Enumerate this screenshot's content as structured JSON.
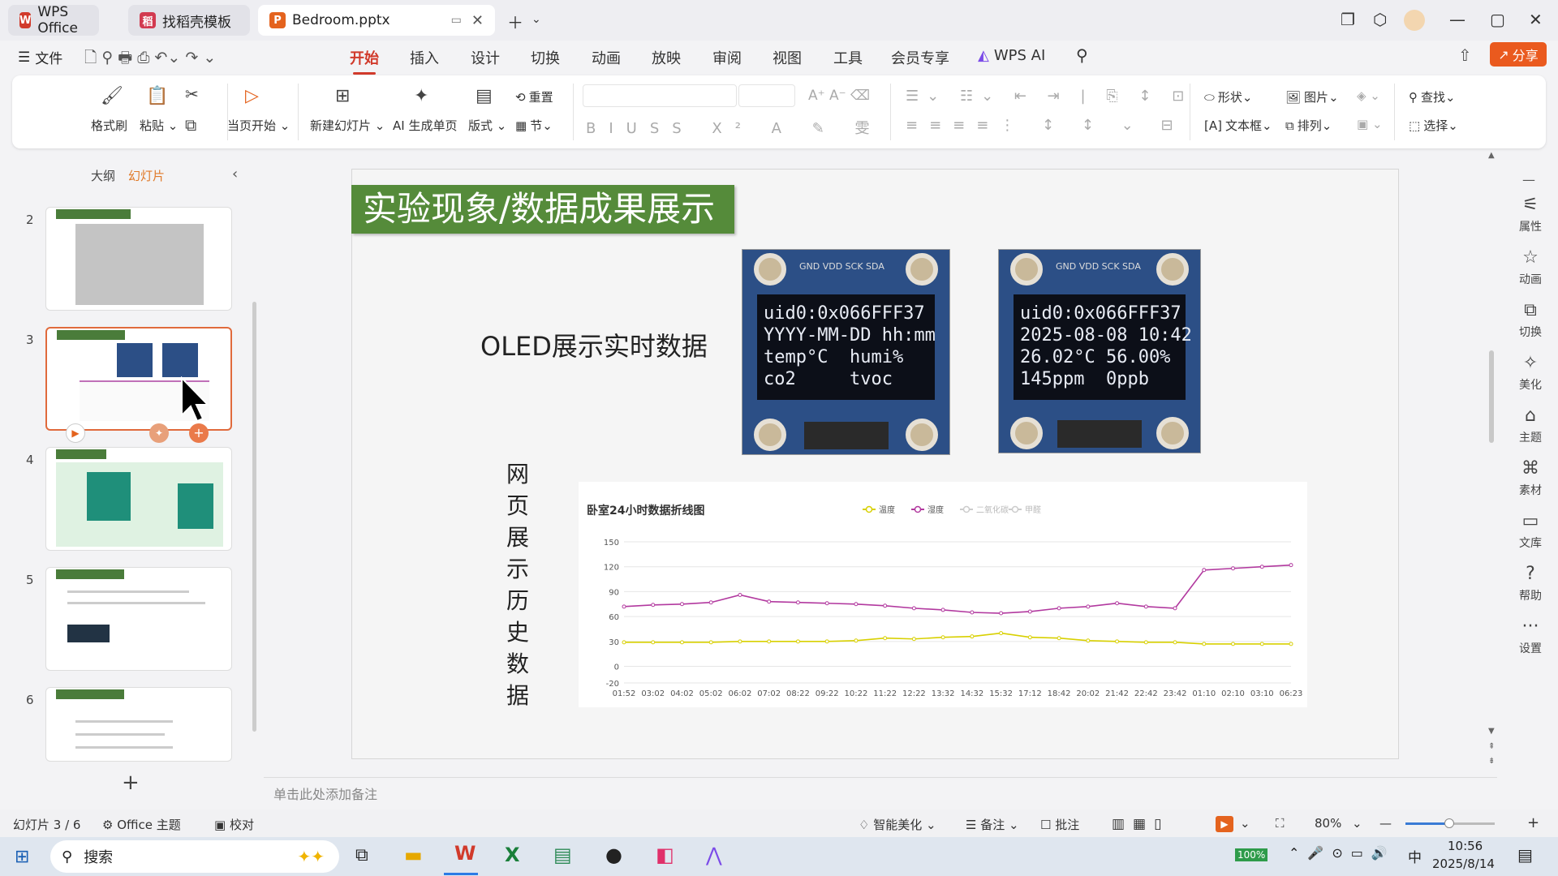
{
  "tabs": [
    {
      "label": "WPS Office"
    },
    {
      "label": "找稻壳模板"
    },
    {
      "label": "Bedroom.pptx"
    }
  ],
  "menu": {
    "file": "文件",
    "items": [
      "开始",
      "插入",
      "设计",
      "切换",
      "动画",
      "放映",
      "审阅",
      "视图",
      "工具",
      "会员专享",
      "WPS AI"
    ],
    "share": "分享"
  },
  "ribbon": {
    "format_painter": "格式刷",
    "paste": "粘贴",
    "from_current": "当页开始",
    "new_slide": "新建幻灯片",
    "ai_gen": "AI 生成单页",
    "layout": "版式",
    "reset": "重置",
    "section": "节",
    "shape": "形状",
    "picture": "图片",
    "find": "查找",
    "textbox": "文本框",
    "arrange": "排列",
    "select": "选择"
  },
  "leftpanel": {
    "outline": "大纲",
    "slides": "幻灯片",
    "numbers": [
      "2",
      "3",
      "4",
      "5",
      "6"
    ]
  },
  "slide": {
    "title": "实验现象/数据成果展示",
    "oled_label": "OLED展示实时数据",
    "web_label": [
      "网",
      "页",
      "展",
      "示",
      "历",
      "史",
      "数",
      "据"
    ],
    "oled1": "uid0:0x066FFF37\nYYYY-MM-DD hh:mm\ntemp°C  humi%\nco2     tvoc",
    "oled2": "uid0:0x066FFF37\n2025-08-08 10:42\n26.02°C 56.00%\n145ppm  0ppb",
    "pins": "GND VDD SCK SDA"
  },
  "chart_data": {
    "type": "line",
    "title": "卧室24小时数据折线图",
    "legend": [
      "温度",
      "湿度",
      "二氧化碳",
      "甲醛"
    ],
    "x": [
      "01:52",
      "03:02",
      "04:02",
      "05:02",
      "06:02",
      "07:02",
      "08:22",
      "09:22",
      "10:22",
      "11:22",
      "12:22",
      "13:32",
      "14:32",
      "15:32",
      "17:12",
      "18:42",
      "20:02",
      "21:42",
      "22:42",
      "23:42",
      "01:10",
      "02:10",
      "03:10",
      "06:23"
    ],
    "ylim": [
      -20,
      150
    ],
    "yticks": [
      150,
      120,
      90,
      60,
      30,
      0,
      -20
    ],
    "series": [
      {
        "name": "温度",
        "color": "#d8d000",
        "values": [
          29,
          29,
          29,
          29,
          30,
          30,
          30,
          30,
          31,
          34,
          33,
          35,
          36,
          40,
          35,
          34,
          31,
          30,
          29,
          29,
          27,
          27,
          27,
          27
        ]
      },
      {
        "name": "湿度",
        "color": "#b2399f",
        "values": [
          72,
          74,
          75,
          77,
          86,
          78,
          77,
          76,
          75,
          73,
          70,
          68,
          65,
          64,
          66,
          70,
          72,
          76,
          72,
          70,
          116,
          118,
          120,
          122
        ]
      }
    ]
  },
  "notes": "单击此处添加备注",
  "status": {
    "slide_count": "幻灯片 3 / 6",
    "theme": "Office 主题",
    "proofread": "校对",
    "beautify": "智能美化",
    "notes": "备注",
    "comments": "批注",
    "zoom": "80%"
  },
  "sidebar": [
    "属性",
    "动画",
    "切换",
    "美化",
    "主题",
    "素材",
    "文库",
    "帮助",
    "设置"
  ],
  "taskbar": {
    "search": "搜索",
    "battery": "100%",
    "ime": "中",
    "time": "10:56",
    "date": "2025/8/14"
  }
}
